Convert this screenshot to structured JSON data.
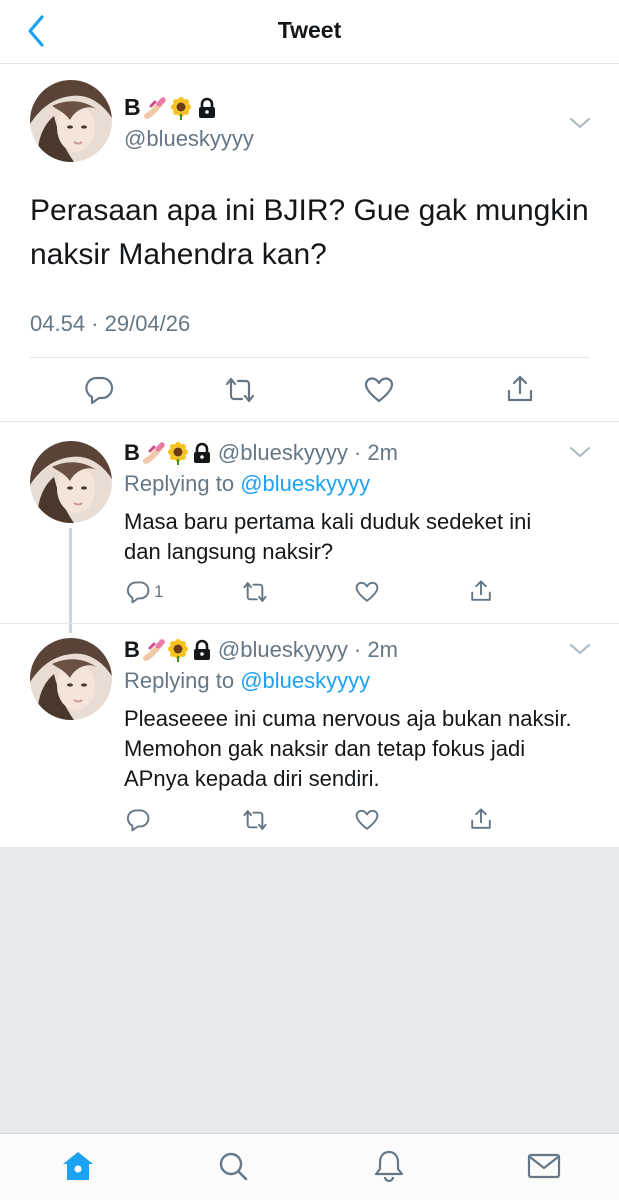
{
  "header": {
    "title": "Tweet"
  },
  "main_tweet": {
    "name": "B",
    "handle": "@blueskyyyy",
    "text": "Perasaan apa ini BJIR? Gue gak mungkin naksir Mahendra kan?",
    "timestamp": "04.54 · 29/04/26"
  },
  "replies": [
    {
      "name": "B",
      "handle_time": "@blueskyyyy · 2m",
      "replying_prefix": "Replying to",
      "replying_handle": "@blueskyyyy",
      "text": "Masa baru pertama kali duduk sedeket ini dan langsung naksir?",
      "reply_count": "1"
    },
    {
      "name": "B",
      "handle_time": "@blueskyyyy · 2m",
      "replying_prefix": "Replying to",
      "replying_handle": "@blueskyyyy",
      "text": "Pleaseeee ini cuma nervous aja bukan naksir. Memohon gak naksir dan tetap fokus jadi APnya kepada diri sendiri.",
      "reply_count": ""
    }
  ],
  "name_emojis": [
    "nail-polish",
    "sunflower",
    "lock"
  ],
  "tabs": [
    "home",
    "search",
    "notifications",
    "messages"
  ],
  "colors": {
    "accent": "#1da1f2",
    "secondary_text": "#657786",
    "icon": "#657786"
  }
}
